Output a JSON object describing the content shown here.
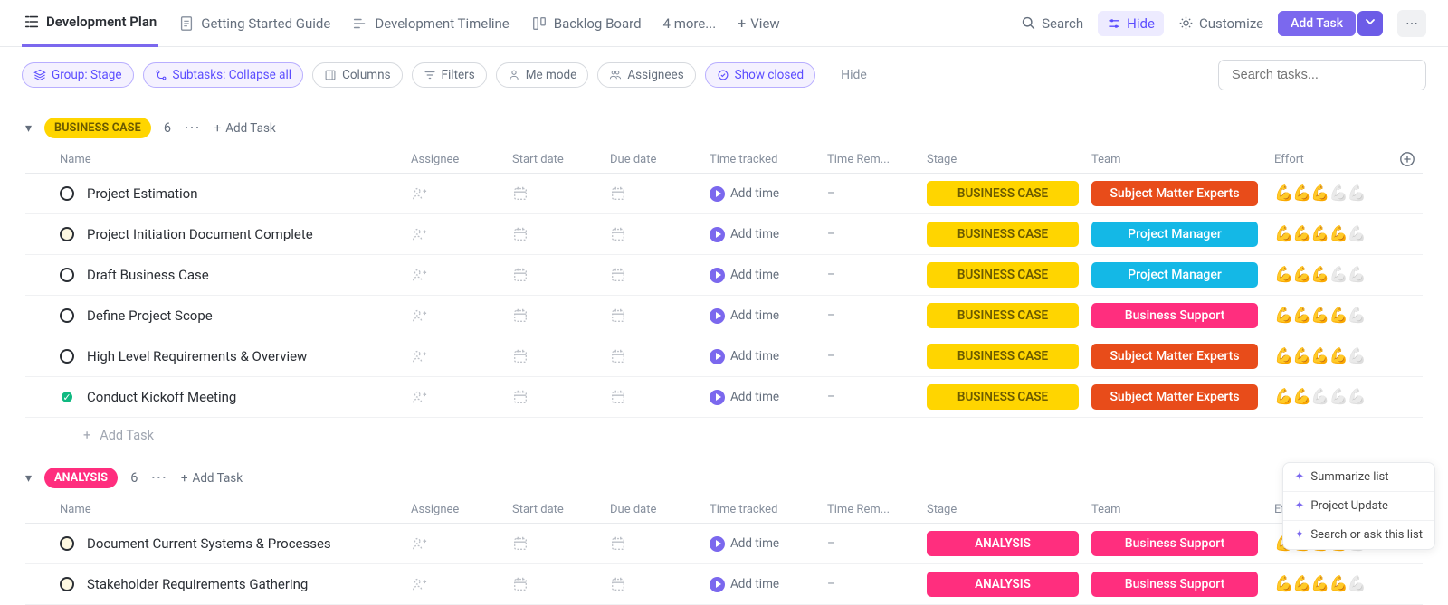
{
  "tabs": [
    {
      "label": "Development Plan",
      "active": true
    },
    {
      "label": "Getting Started Guide"
    },
    {
      "label": "Development Timeline"
    },
    {
      "label": "Backlog Board"
    },
    {
      "label": "4 more...",
      "plain": true
    }
  ],
  "top": {
    "view": "View",
    "search": "Search",
    "hide": "Hide",
    "customize": "Customize",
    "add_task": "Add Task"
  },
  "filters": {
    "group": "Group: Stage",
    "subtasks": "Subtasks: Collapse all",
    "columns": "Columns",
    "filters": "Filters",
    "me_mode": "Me mode",
    "assignees": "Assignees",
    "show_closed": "Show closed",
    "hide": "Hide",
    "search_placeholder": "Search tasks..."
  },
  "columns": {
    "name": "Name",
    "assignee": "Assignee",
    "start": "Start date",
    "due": "Due date",
    "time": "Time tracked",
    "remain": "Time Rem...",
    "stage": "Stage",
    "team": "Team",
    "effort": "Effort"
  },
  "groups": [
    {
      "label": "BUSINESS CASE",
      "color": "stage-yellow",
      "count": "6",
      "add": "Add Task",
      "stage_class": "st-yellow",
      "tasks": [
        {
          "name": "Project Estimation",
          "status": "dot-cyan",
          "stage": "BUSINESS CASE",
          "team": "Subject Matter Experts",
          "team_class": "t-orange",
          "effort": 3
        },
        {
          "name": "Project Initiation Document Complete",
          "status": "dot-orange",
          "stage": "BUSINESS CASE",
          "team": "Project Manager",
          "team_class": "t-blue",
          "effort": 4
        },
        {
          "name": "Draft Business Case",
          "status": "dot-red",
          "stage": "BUSINESS CASE",
          "team": "Project Manager",
          "team_class": "t-blue",
          "effort": 3
        },
        {
          "name": "Define Project Scope",
          "status": "dot-cyan",
          "stage": "BUSINESS CASE",
          "team": "Business Support",
          "team_class": "t-pink",
          "effort": 4
        },
        {
          "name": "High Level Requirements & Overview",
          "status": "dot-cyan",
          "stage": "BUSINESS CASE",
          "team": "Subject Matter Experts",
          "team_class": "t-orange",
          "effort": 4
        },
        {
          "name": "Conduct Kickoff Meeting",
          "status": "dot-done",
          "stage": "BUSINESS CASE",
          "team": "Subject Matter Experts",
          "team_class": "t-orange",
          "effort": 2
        }
      ]
    },
    {
      "label": "ANALYSIS",
      "color": "stage-pink",
      "count": "6",
      "add": "Add Task",
      "stage_class": "st-pink",
      "tasks": [
        {
          "name": "Document Current Systems & Processes",
          "status": "dot-orange",
          "stage": "ANALYSIS",
          "team": "Business Support",
          "team_class": "t-pink",
          "effort": 4
        },
        {
          "name": "Stakeholder Requirements Gathering",
          "status": "dot-orange",
          "stage": "ANALYSIS",
          "team": "Business Support",
          "team_class": "t-pink",
          "effort": 4
        }
      ]
    }
  ],
  "add_time": "Add time",
  "add_task_row": "Add Task",
  "float": {
    "summarize": "Summarize list",
    "project_update": "Project Update",
    "search_ask": "Search or ask this list"
  }
}
